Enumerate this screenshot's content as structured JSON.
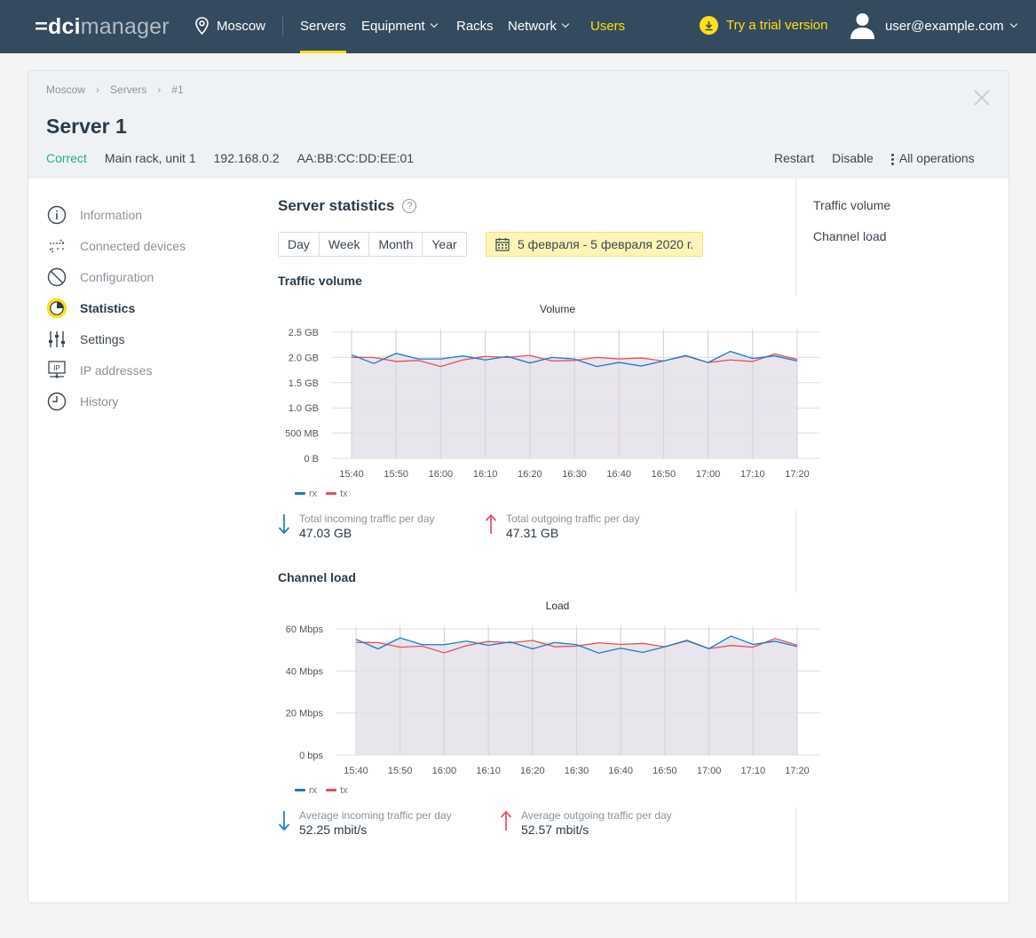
{
  "nav": {
    "logo_dci": "dci",
    "logo_manager": "manager",
    "location": "Moscow",
    "items": [
      {
        "label": "Servers",
        "active": true,
        "dropdown": false
      },
      {
        "label": "Equipment",
        "active": false,
        "dropdown": true
      },
      {
        "label": "Racks",
        "active": false,
        "dropdown": false
      },
      {
        "label": "Network",
        "active": false,
        "dropdown": true
      },
      {
        "label": "Users",
        "active": false,
        "dropdown": false
      }
    ],
    "trial": "Try a trial version",
    "user": "user@example.com"
  },
  "header": {
    "breadcrumbs": [
      "Moscow",
      "Servers",
      "#1"
    ],
    "title": "Server 1",
    "status": "Correct",
    "rack": "Main rack, unit 1",
    "ip": "192.168.0.2",
    "mac": "AA:BB:CC:DD:EE:01",
    "actions": {
      "restart": "Restart",
      "disable": "Disable",
      "all": "All operations"
    }
  },
  "sidebar": {
    "items": [
      {
        "label": "Information",
        "icon": "info-icon"
      },
      {
        "label": "Connected devices",
        "icon": "connected-devices-icon"
      },
      {
        "label": "Configuration",
        "icon": "configuration-icon"
      },
      {
        "label": "Statistics",
        "icon": "statistics-icon",
        "active": true
      },
      {
        "label": "Settings",
        "icon": "settings-sliders-icon"
      },
      {
        "label": "IP addresses",
        "icon": "ip-icon"
      },
      {
        "label": "History",
        "icon": "history-clock-icon"
      }
    ]
  },
  "main": {
    "title": "Server statistics",
    "help": "?",
    "periods": [
      "Day",
      "Week",
      "Month",
      "Year"
    ],
    "date_range": "5 февраля - 5 февраля 2020 г.",
    "traffic_section": "Traffic volume",
    "load_section": "Channel load",
    "stats_traffic": {
      "in_label": "Total incoming traffic per day",
      "in_value": "47.03 GB",
      "out_label": "Total outgoing traffic per day",
      "out_value": "47.31 GB"
    },
    "stats_load": {
      "in_label": "Average incoming traffic per day",
      "in_value": "52.25 mbit/s",
      "out_label": "Average outgoing traffic per day",
      "out_value": "52.57 mbit/s"
    }
  },
  "right_nav": [
    "Traffic volume",
    "Channel load"
  ],
  "colors": {
    "rx": "#1f7bc0",
    "tx": "#e0505e",
    "fill": "#e4e1ea",
    "accent": "#fde017",
    "status": "#2dad7f"
  },
  "chart_data": [
    {
      "type": "line",
      "title": "Volume",
      "x": [
        "15:40",
        "15:45",
        "15:50",
        "15:55",
        "16:00",
        "16:05",
        "16:10",
        "16:15",
        "16:20",
        "16:25",
        "16:30",
        "16:35",
        "16:40",
        "16:45",
        "16:50",
        "16:55",
        "17:00",
        "17:05",
        "17:10",
        "17:15",
        "17:20"
      ],
      "x_tick_labels": [
        "15:40",
        "15:50",
        "16:00",
        "16:10",
        "16:20",
        "16:30",
        "16:40",
        "16:50",
        "17:00",
        "17:10",
        "17:20"
      ],
      "y_tick_labels": [
        "0 B",
        "500 MB",
        "1.0 GB",
        "1.5 GB",
        "2.0 GB",
        "2.5 GB"
      ],
      "ylim": [
        0,
        2.5
      ],
      "y_unit": "GB",
      "series": [
        {
          "name": "rx",
          "values": [
            2.05,
            1.88,
            2.08,
            1.97,
            1.97,
            2.03,
            1.95,
            2.02,
            1.89,
            2.0,
            1.97,
            1.82,
            1.9,
            1.83,
            1.93,
            2.04,
            1.9,
            2.12,
            1.98,
            2.03,
            1.93
          ]
        },
        {
          "name": "tx",
          "values": [
            2.0,
            2.0,
            1.92,
            1.94,
            1.82,
            1.95,
            2.02,
            2.0,
            2.04,
            1.93,
            1.94,
            2.0,
            1.97,
            1.99,
            1.93,
            2.03,
            1.9,
            1.95,
            1.92,
            2.07,
            1.96
          ]
        }
      ],
      "legend": [
        "rx",
        "tx"
      ],
      "grid": true,
      "area_fill": true
    },
    {
      "type": "line",
      "title": "Load",
      "x": [
        "15:40",
        "15:45",
        "15:50",
        "15:55",
        "16:00",
        "16:05",
        "16:10",
        "16:15",
        "16:20",
        "16:25",
        "16:30",
        "16:35",
        "16:40",
        "16:45",
        "16:50",
        "16:55",
        "17:00",
        "17:05",
        "17:10",
        "17:15",
        "17:20"
      ],
      "x_tick_labels": [
        "15:40",
        "15:50",
        "16:00",
        "16:10",
        "16:20",
        "16:30",
        "16:40",
        "16:50",
        "17:00",
        "17:10",
        "17:20"
      ],
      "y_tick_labels": [
        "0 bps",
        "20 Mbps",
        "40 Mbps",
        "60 Mbps"
      ],
      "ylim": [
        0,
        60
      ],
      "y_unit": "Mbps",
      "series": [
        {
          "name": "rx",
          "values": [
            55.0,
            50.5,
            55.7,
            52.5,
            52.5,
            54.2,
            52.2,
            53.8,
            50.5,
            53.5,
            52.5,
            48.5,
            50.8,
            48.8,
            51.5,
            54.6,
            50.6,
            56.6,
            52.6,
            54.1,
            51.6
          ]
        },
        {
          "name": "tx",
          "values": [
            53.5,
            53.5,
            51.3,
            51.8,
            48.6,
            52.0,
            54.0,
            53.4,
            54.5,
            51.5,
            51.8,
            53.4,
            52.6,
            53.1,
            51.5,
            54.3,
            50.6,
            52.1,
            51.3,
            55.4,
            52.3
          ]
        }
      ],
      "legend": [
        "rx",
        "tx"
      ],
      "grid": true,
      "area_fill": true
    }
  ]
}
